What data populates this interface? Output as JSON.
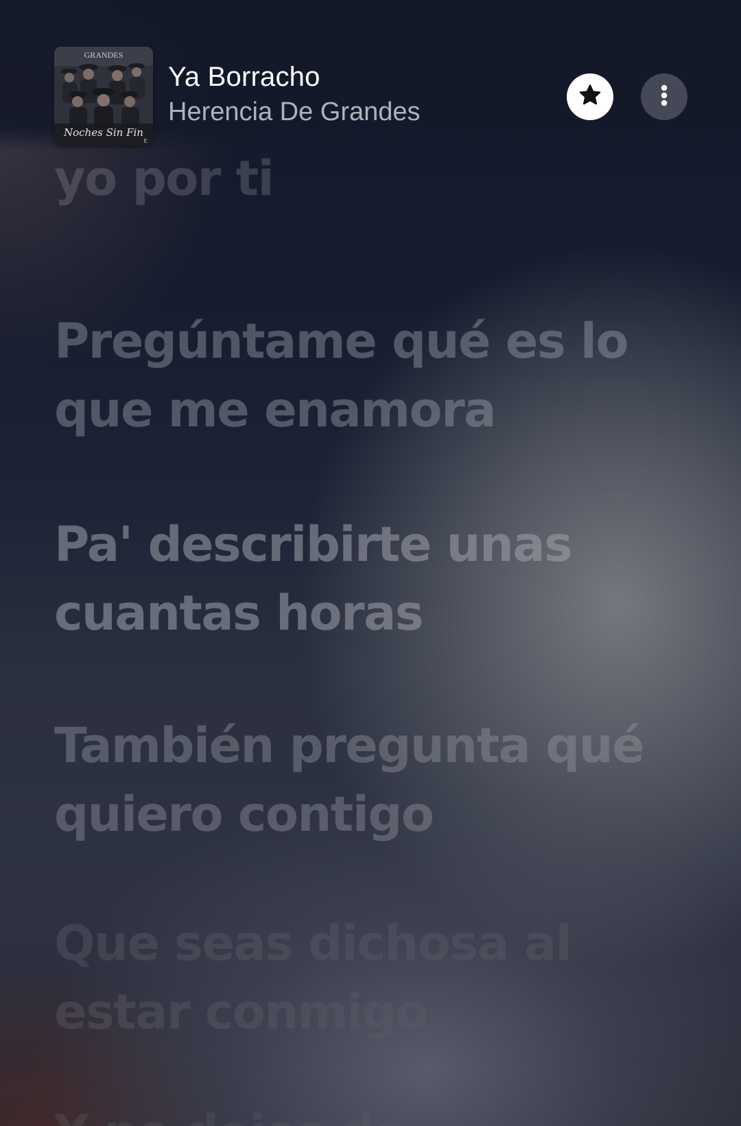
{
  "now_playing": {
    "title": "Ya Borracho",
    "artist": "Herencia De Grandes",
    "album_art": {
      "top_text": "GRANDES",
      "script_text": "Noches Sin Fin",
      "label": "E"
    }
  },
  "header": {
    "star_icon": "star-icon",
    "more_icon": "more-vertical-icon"
  },
  "lyrics": {
    "previous_line": "yo por ti",
    "lines": [
      "Pregúntame qué es lo que me enamora",
      "Pa' describirte unas cuantas horas",
      "También pregunta qué quiero contigo",
      "Que seas dichosa al estar conmigo"
    ],
    "next_line": "Y no dejes de ..."
  },
  "colors": {
    "star_button_bg": "#ffffff",
    "star_icon": "#111111",
    "more_button_bg": "#6e707a"
  }
}
